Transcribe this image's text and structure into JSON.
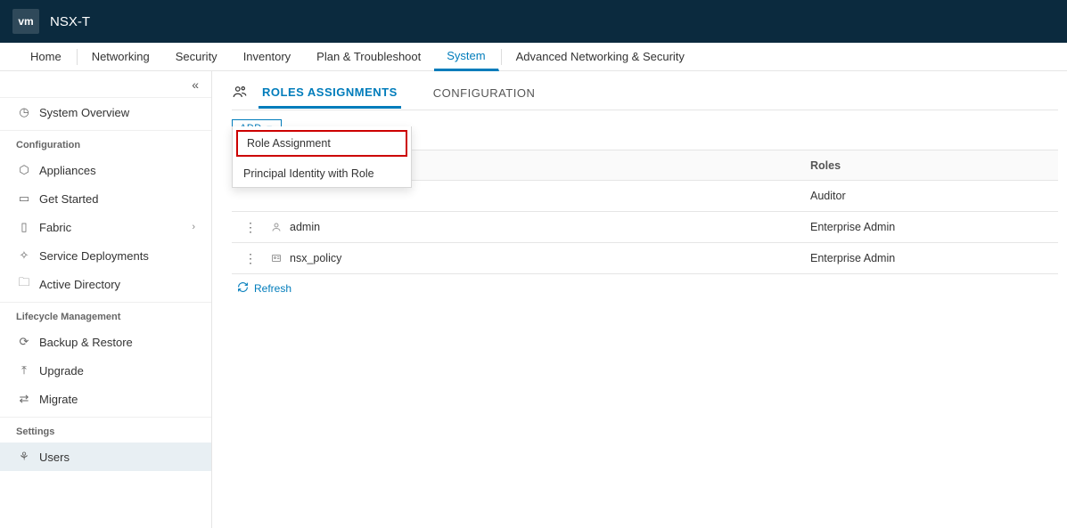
{
  "header": {
    "logo_text": "vm",
    "product": "NSX-T"
  },
  "nav": {
    "items": [
      {
        "label": "Home"
      },
      {
        "label": "Networking"
      },
      {
        "label": "Security"
      },
      {
        "label": "Inventory"
      },
      {
        "label": "Plan & Troubleshoot"
      },
      {
        "label": "System",
        "active": true
      },
      {
        "label": "Advanced Networking & Security"
      }
    ]
  },
  "sidebar": {
    "overview": "System Overview",
    "groups": [
      {
        "title": "Configuration",
        "items": [
          {
            "icon": "⬡",
            "label": "Appliances"
          },
          {
            "icon": "▭",
            "label": "Get Started"
          },
          {
            "icon": "▯",
            "label": "Fabric",
            "expandable": true
          },
          {
            "icon": "✧",
            "label": "Service Deployments"
          },
          {
            "icon": "🗀",
            "label": "Active Directory"
          }
        ]
      },
      {
        "title": "Lifecycle Management",
        "items": [
          {
            "icon": "⟳",
            "label": "Backup & Restore"
          },
          {
            "icon": "⤒",
            "label": "Upgrade"
          },
          {
            "icon": "⇄",
            "label": "Migrate"
          }
        ]
      },
      {
        "title": "Settings",
        "items": [
          {
            "icon": "⚘",
            "label": "Users",
            "selected": true
          }
        ]
      }
    ]
  },
  "subtabs": {
    "items": [
      {
        "label": "ROLES ASSIGNMENTS",
        "active": true
      },
      {
        "label": "CONFIGURATION"
      }
    ]
  },
  "add_button": "ADD",
  "dropdown": {
    "items": [
      {
        "label": "Role Assignment",
        "highlight": true
      },
      {
        "label": "Principal Identity with Role"
      }
    ]
  },
  "table": {
    "headers": {
      "user": "",
      "roles": "Roles"
    },
    "rows": [
      {
        "user": "",
        "roles": "Auditor",
        "icon": "☺",
        "has_dots": false
      },
      {
        "user": "admin",
        "roles": "Enterprise Admin",
        "icon": "♟",
        "has_dots": true
      },
      {
        "user": "nsx_policy",
        "roles": "Enterprise Admin",
        "icon": "▭",
        "has_dots": true
      }
    ]
  },
  "refresh_label": "Refresh"
}
